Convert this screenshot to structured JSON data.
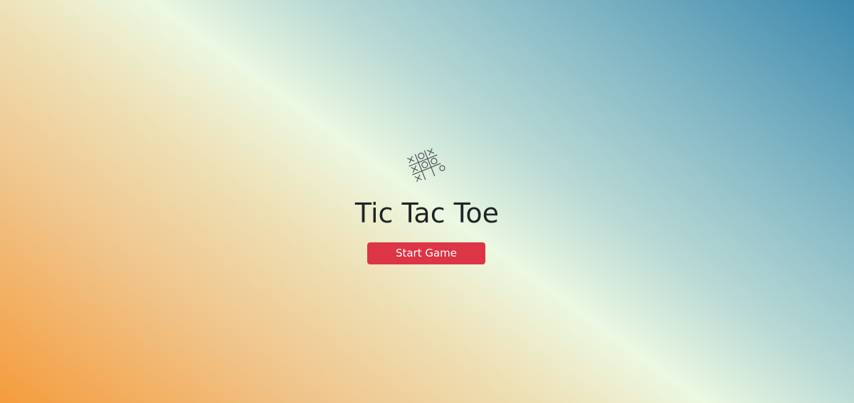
{
  "app": {
    "title": "Tic Tac Toe",
    "start_button_label": "Start Game"
  },
  "logo": {
    "icon": "tic-tac-toe-grid-icon"
  },
  "colors": {
    "button": "#dc3545",
    "button_text": "#ffffff",
    "title_text": "#1f2426",
    "background_start": "#f59c3c",
    "background_mid": "#ecf8e2",
    "background_end": "#3d88ad"
  }
}
